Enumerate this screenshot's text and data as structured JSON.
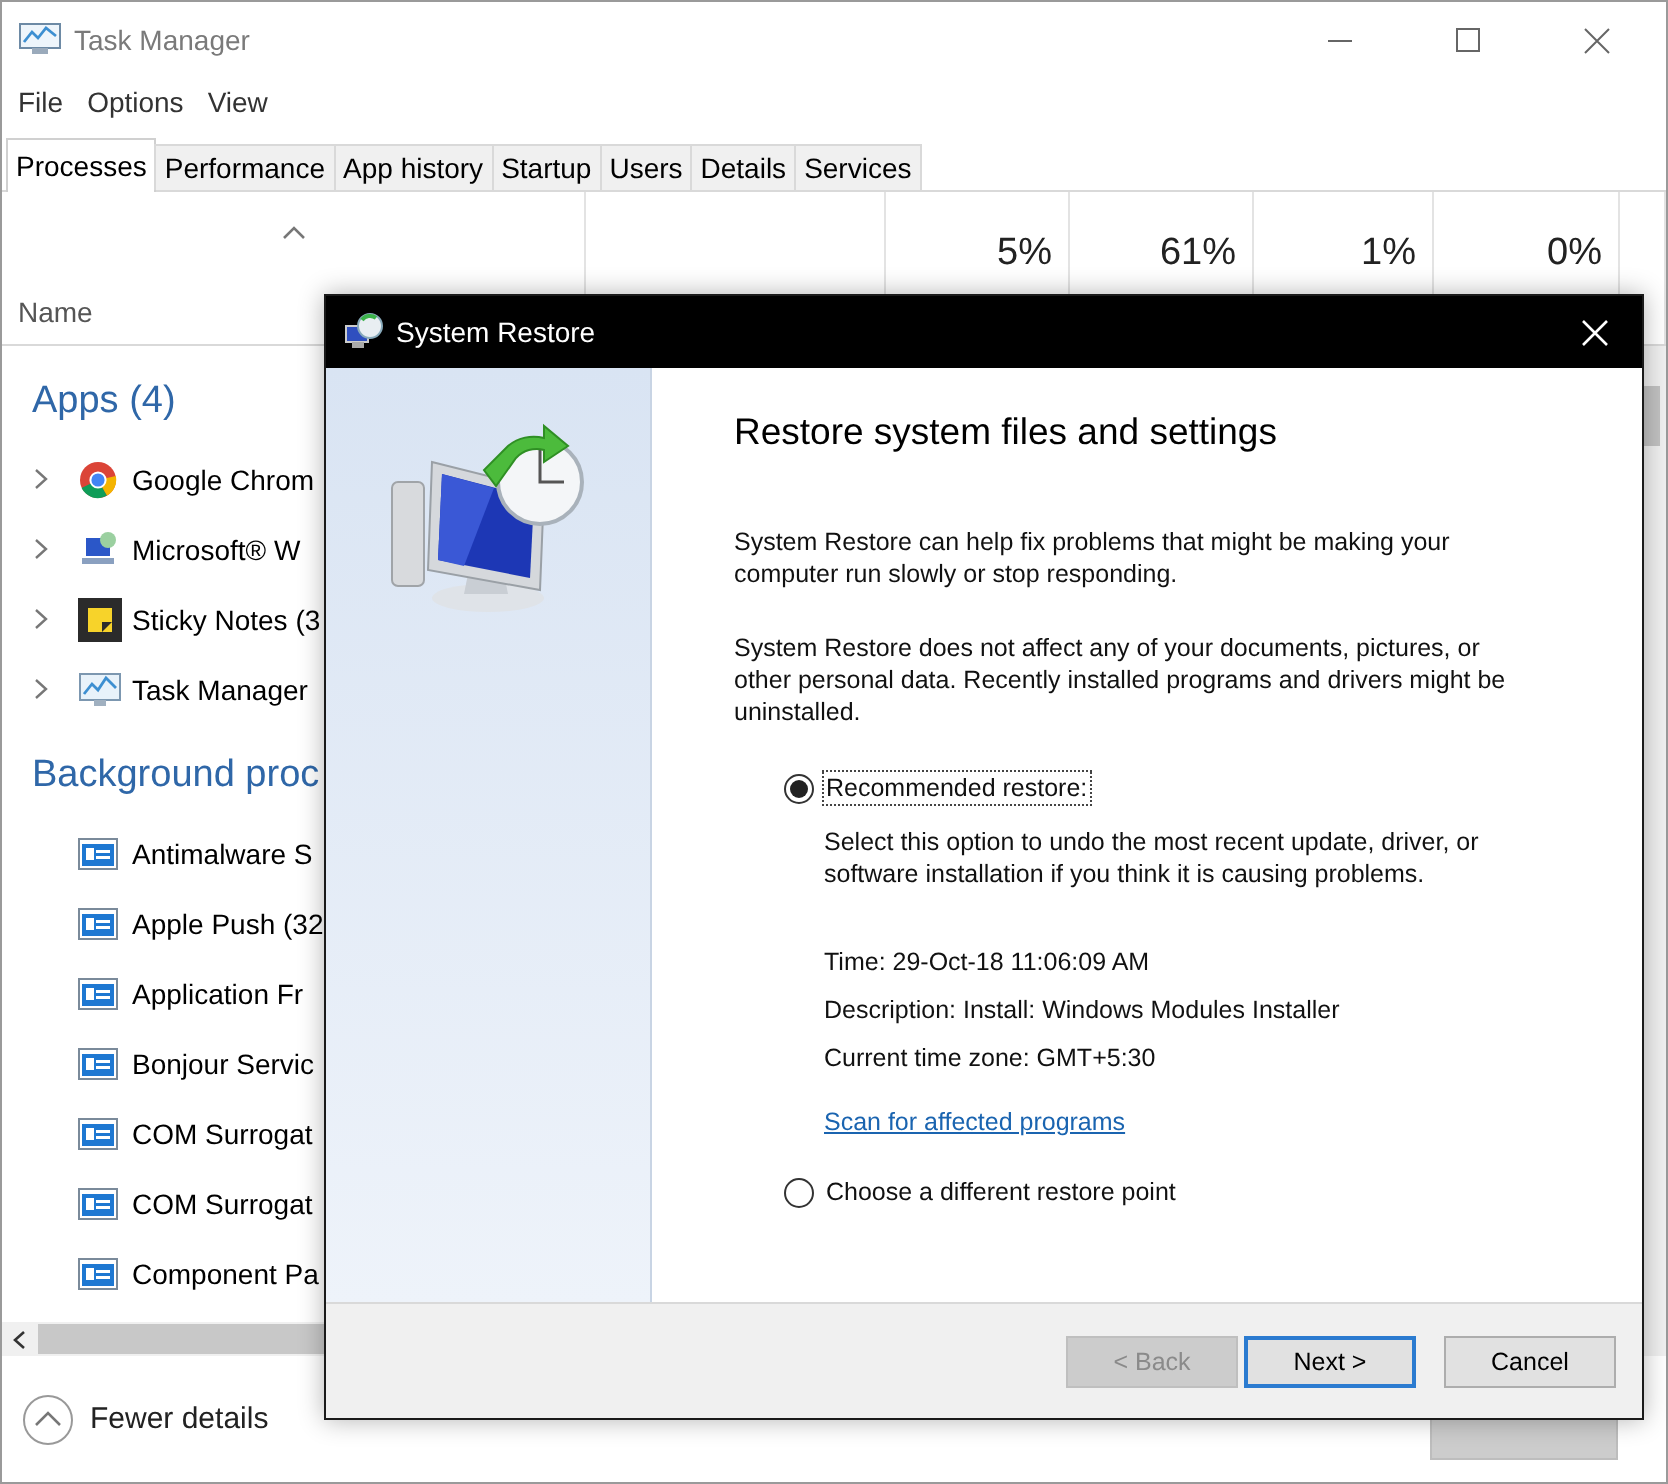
{
  "task_manager": {
    "title": "Task Manager",
    "menu": [
      "File",
      "Options",
      "View"
    ],
    "tabs": [
      {
        "label": "Processes",
        "selected": true
      },
      {
        "label": "Performance",
        "selected": false
      },
      {
        "label": "App history",
        "selected": false
      },
      {
        "label": "Startup",
        "selected": false
      },
      {
        "label": "Users",
        "selected": false
      },
      {
        "label": "Details",
        "selected": false
      },
      {
        "label": "Services",
        "selected": false
      }
    ],
    "name_column": "Name",
    "stats": [
      "5%",
      "61%",
      "1%",
      "0%"
    ],
    "groups": [
      {
        "title": "Apps (4)",
        "processes": [
          {
            "name": "Google Chrom",
            "expandable": true
          },
          {
            "name": "Microsoft® W",
            "expandable": true
          },
          {
            "name": "Sticky Notes (3",
            "expandable": true
          },
          {
            "name": "Task Manager",
            "expandable": true
          }
        ]
      },
      {
        "title": "Background proc",
        "processes": [
          {
            "name": "Antimalware S",
            "expandable": false
          },
          {
            "name": "Apple Push (32",
            "expandable": false
          },
          {
            "name": "Application Fr",
            "expandable": false
          },
          {
            "name": "Bonjour Servic",
            "expandable": false
          },
          {
            "name": "COM Surrogat",
            "expandable": false
          },
          {
            "name": "COM Surrogat",
            "expandable": false
          },
          {
            "name": "Component Pa",
            "expandable": false
          }
        ]
      }
    ],
    "fewer_details": "Fewer details"
  },
  "dialog": {
    "title": "System Restore",
    "heading": "Restore system files and settings",
    "paragraphs": [
      "System Restore can help fix problems that might be making your computer run slowly or stop responding.",
      "System Restore does not affect any of your documents, pictures, or other personal data. Recently installed programs and drivers might be uninstalled."
    ],
    "options": [
      {
        "label": "Recommended restore:",
        "selected": true,
        "description": "Select this option to undo the most recent update, driver, or software installation if you think it is causing problems.",
        "details": [
          "Time: 29-Oct-18 11:06:09 AM",
          "Description: Install: Windows Modules Installer",
          "Current time zone: GMT+5:30"
        ],
        "link": "Scan for affected programs"
      },
      {
        "label": "Choose a different restore point",
        "selected": false
      }
    ],
    "buttons": [
      {
        "label": "< Back",
        "disabled": true,
        "default": false
      },
      {
        "label": "Next >",
        "disabled": false,
        "default": true
      },
      {
        "label": "Cancel",
        "disabled": false,
        "default": false
      }
    ]
  }
}
